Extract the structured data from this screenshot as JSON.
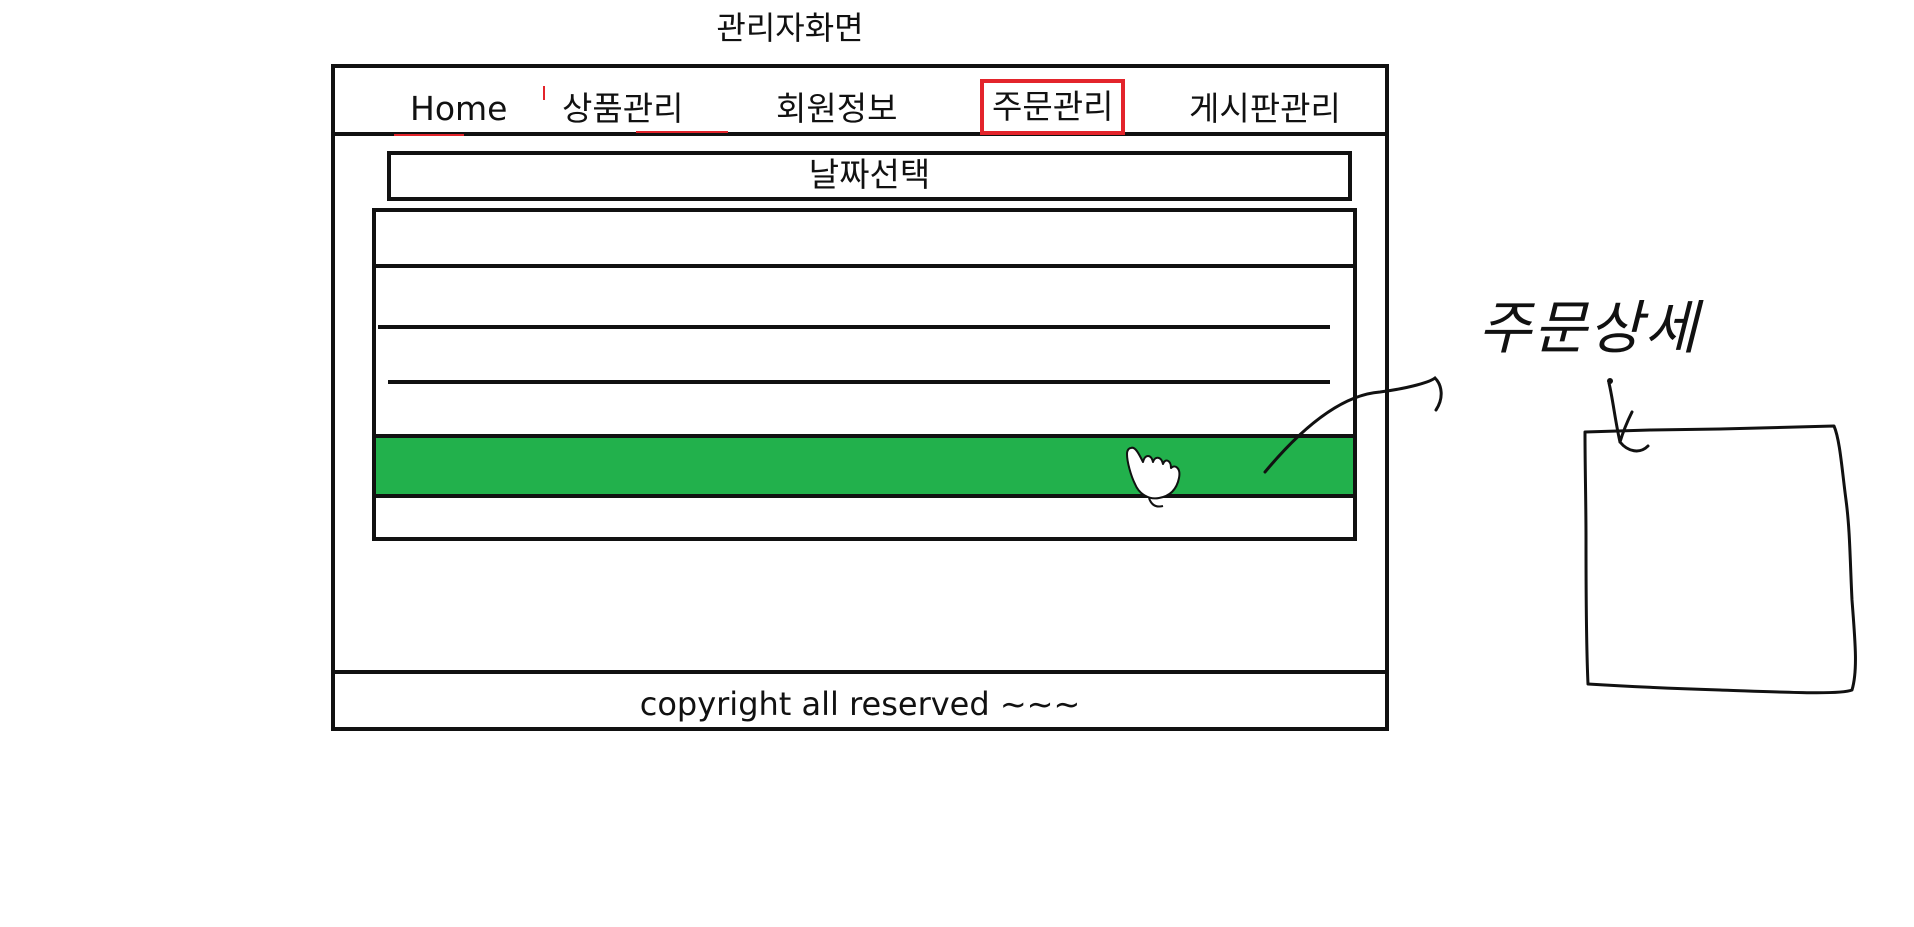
{
  "page": {
    "title": "관리자화면"
  },
  "nav": {
    "items": [
      {
        "label": "Home"
      },
      {
        "label": "상품관리"
      },
      {
        "label": "회원정보"
      },
      {
        "label": "주문관리",
        "selected": true
      },
      {
        "label": "게시판관리"
      }
    ]
  },
  "date_filter": {
    "label": "날짜선택"
  },
  "order_list": {
    "row_count": 6,
    "selected_row": 5,
    "selected_color": "#22b14c"
  },
  "footer": {
    "text": "copyright all reserved ~~~"
  },
  "detail_panel": {
    "label": "주문상세"
  },
  "colors": {
    "accent_red": "#e3242b",
    "selected_green": "#22b14c",
    "ink": "#111111"
  },
  "icons": {
    "cursor": "hand-pointer-icon",
    "arrow": "curved-arrow-icon"
  }
}
